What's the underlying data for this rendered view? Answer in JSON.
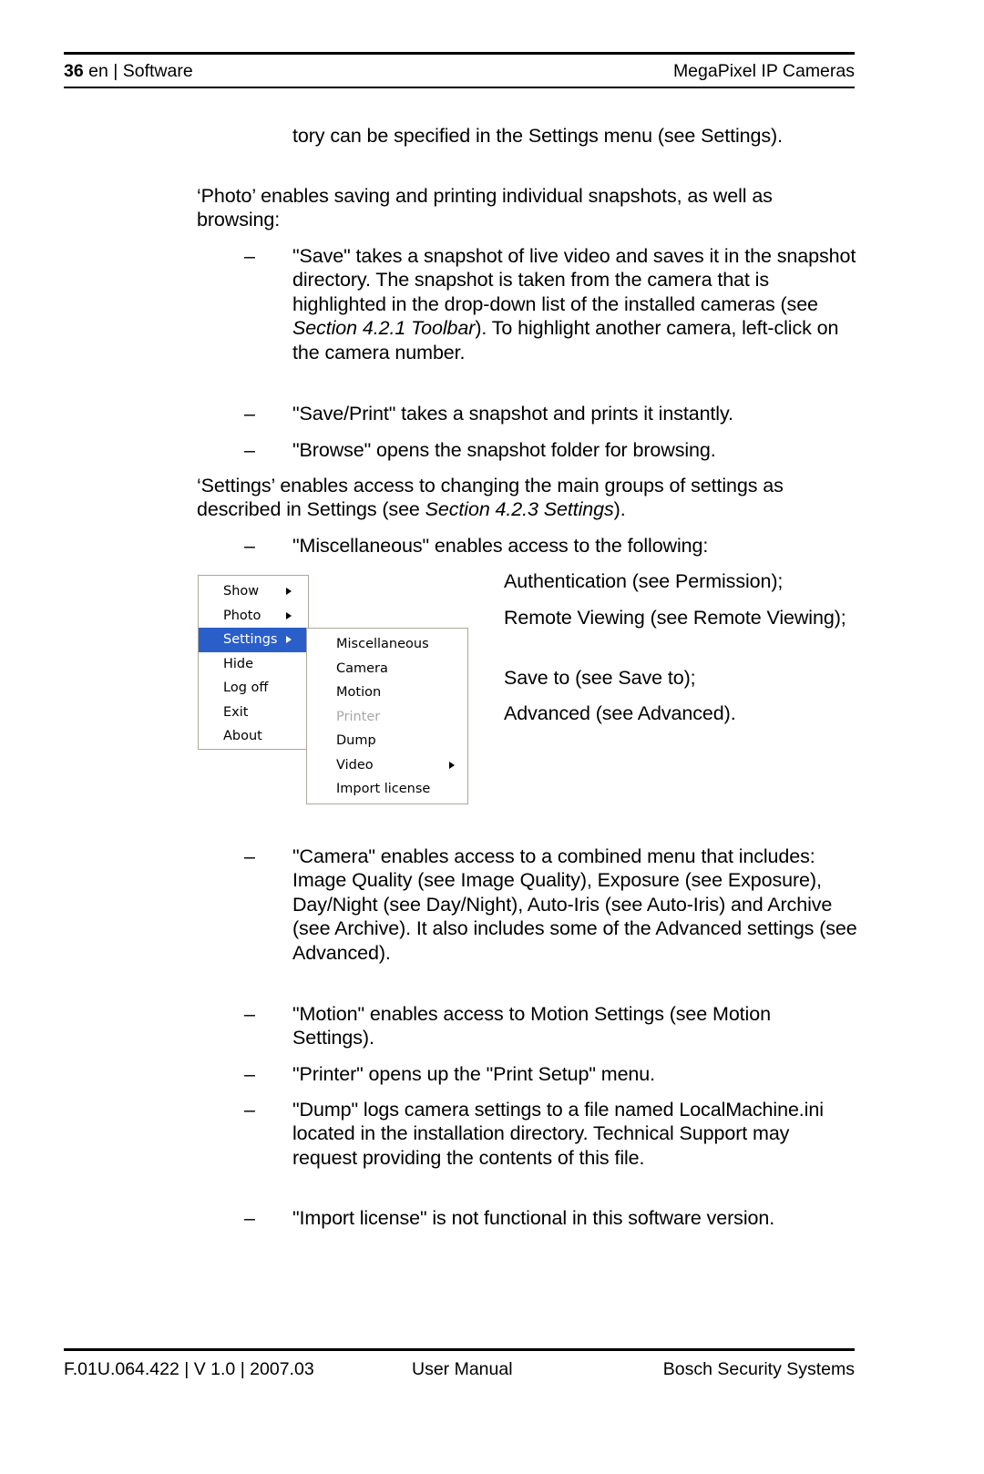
{
  "header": {
    "page_number": "36",
    "left_text": " en | Software",
    "right_text": "MegaPixel IP Cameras"
  },
  "body": {
    "continuation_paragraph": "tory can be specified in the Settings menu (see Settings).",
    "photo_paragraph": "‘Photo’ enables saving and printing individual snapshots, as well as browsing:",
    "photo_items": [
      {
        "dash": "–",
        "text_before_italic": "\"Save\" takes a snapshot of live video and saves it in the snapshot directory. The snapshot is taken from the camera that is highlighted in the drop-down list of the installed cameras (see ",
        "italic": "Section 4.2.1 Toolbar",
        "text_after_italic": "). To highlight another camera, left-click on the camera number."
      },
      {
        "dash": "–",
        "text": "\"Save/Print\" takes a snapshot and prints it instantly."
      },
      {
        "dash": "–",
        "text": "\"Browse\" opens the snapshot folder for browsing."
      }
    ],
    "settings_paragraph_before_italic": "‘Settings’ enables access to changing the main groups of settings as described in Settings (see ",
    "settings_paragraph_italic": "Section 4.2.3 Settings",
    "settings_paragraph_after_italic": ").",
    "misc_item": {
      "dash": "–",
      "text": "\"Miscellaneous\" enables access to the following:"
    },
    "misc_sublist": [
      "Authentication (see Permission);",
      "Remote Viewing (see Remote Viewing);",
      "Save to (see Save to);",
      "Advanced (see Advanced)."
    ],
    "settings_items": [
      {
        "dash": "–",
        "text": "\"Camera\" enables access to a combined menu that includes: Image Quality (see Image Quality), Exposure (see Exposure), Day/Night (see Day/Night), Auto-Iris (see Auto-Iris) and Archive (see Archive). It also includes some of the Advanced settings (see Advanced)."
      },
      {
        "dash": "–",
        "text": "\"Motion\" enables access to Motion Settings (see Motion Settings)."
      },
      {
        "dash": "–",
        "text": "\"Printer\" opens up the \"Print Setup\" menu."
      },
      {
        "dash": "–",
        "text": "\"Dump\" logs camera settings to a file named LocalMachine.ini located in the installation directory. Technical Support may request providing the contents of this file."
      },
      {
        "dash": "–",
        "text": "\"Import license\" is not functional in this software version."
      }
    ]
  },
  "figure_menu": {
    "highlight_color": "#2a5fc9",
    "border_color": "#aca899",
    "disabled_color": "#a7a7a7",
    "main_menu": [
      {
        "label": "Show",
        "has_submenu": true,
        "selected": false,
        "disabled": false
      },
      {
        "label": "Photo",
        "has_submenu": true,
        "selected": false,
        "disabled": false
      },
      {
        "label": "Settings",
        "has_submenu": true,
        "selected": true,
        "disabled": false
      },
      {
        "label": "Hide",
        "has_submenu": false,
        "selected": false,
        "disabled": false
      },
      {
        "label": "Log off",
        "has_submenu": false,
        "selected": false,
        "disabled": false
      },
      {
        "label": "Exit",
        "has_submenu": false,
        "selected": false,
        "disabled": false
      },
      {
        "label": "About",
        "has_submenu": false,
        "selected": false,
        "disabled": false
      }
    ],
    "submenu": [
      {
        "label": "Miscellaneous",
        "has_submenu": false,
        "disabled": false
      },
      {
        "label": "Camera",
        "has_submenu": false,
        "disabled": false
      },
      {
        "label": "Motion",
        "has_submenu": false,
        "disabled": false
      },
      {
        "label": "Printer",
        "has_submenu": false,
        "disabled": true
      },
      {
        "label": "Dump",
        "has_submenu": false,
        "disabled": false
      },
      {
        "label": "Video",
        "has_submenu": true,
        "disabled": false
      },
      {
        "label": "Import license",
        "has_submenu": false,
        "disabled": false
      }
    ]
  },
  "footer": {
    "left": "F.01U.064.422 | V 1.0 | 2007.03",
    "center": "User Manual",
    "right": "Bosch Security Systems"
  }
}
